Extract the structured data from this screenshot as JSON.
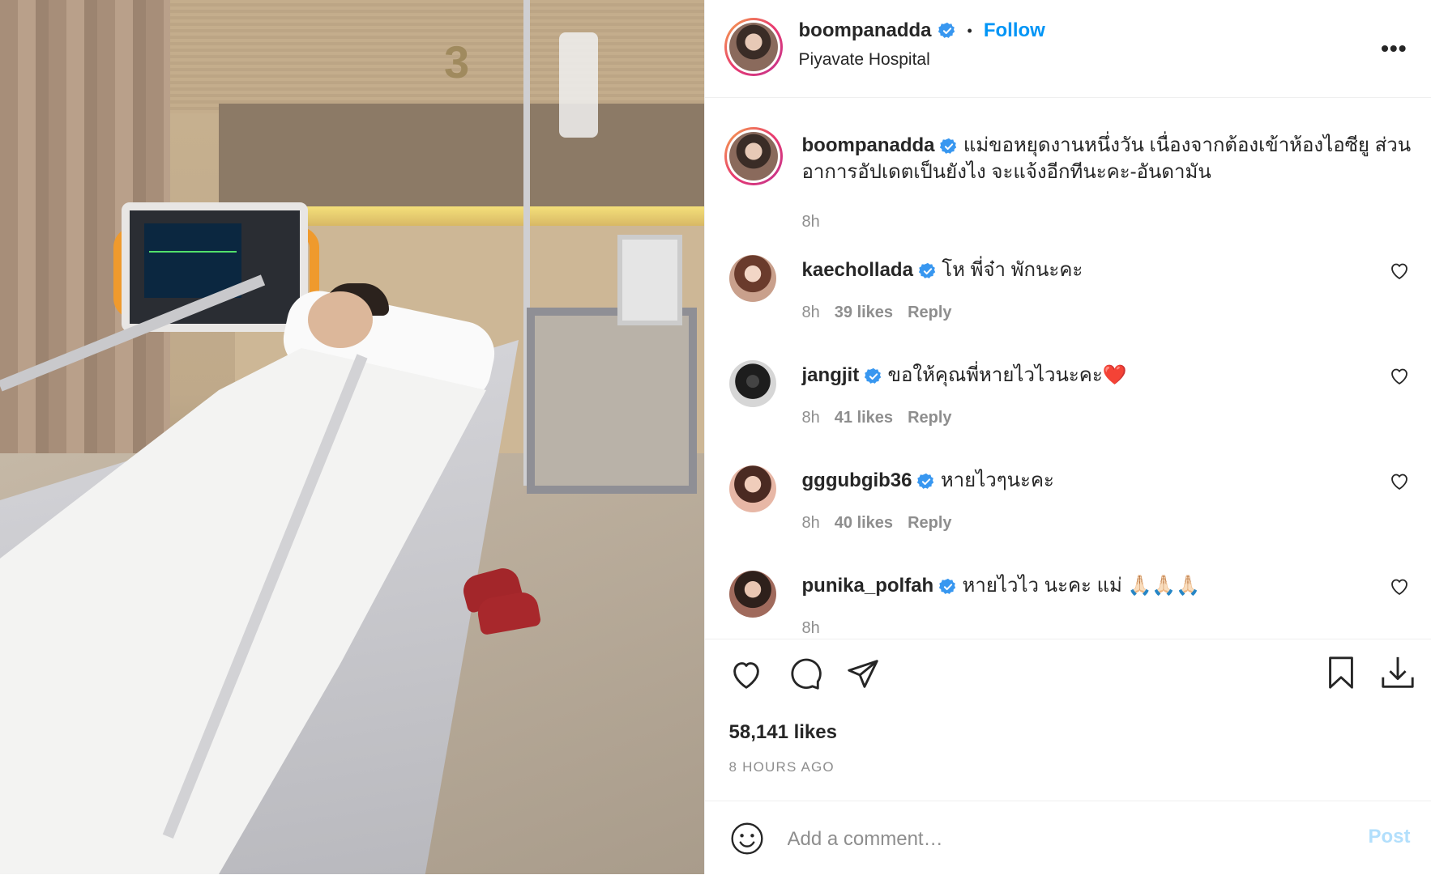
{
  "post": {
    "author": "boompanadda",
    "location": "Piyavate Hospital",
    "follow_label": "Follow",
    "separator": "•",
    "more_icon": "more-options-icon",
    "room_number": "3"
  },
  "caption": {
    "username": "boompanadda",
    "text_line1": "แม่ขอหยุดงานหนึ่งวัน เนื่องจากต้องเข้าห้องไอซียู ส่วน",
    "text_line2": "อาการอัปเดตเป็นยังไง จะแจ้งอีกทีนะคะ-อันดามัน",
    "time": "8h"
  },
  "comments": [
    {
      "username": "kaechollada",
      "text": "โห พี่จ๋า พักนะคะ",
      "time": "8h",
      "likes": "39 likes",
      "reply": "Reply"
    },
    {
      "username": "jangjit",
      "text": "ขอให้คุณพี่หายไวไวนะคะ❤️",
      "time": "8h",
      "likes": "41 likes",
      "reply": "Reply"
    },
    {
      "username": "gggubgib36",
      "text": "หายไวๆนะคะ",
      "time": "8h",
      "likes": "40 likes",
      "reply": "Reply"
    },
    {
      "username": "punika_polfah",
      "text": "หายไวไว นะคะ แม่ 🙏🏻🙏🏻🙏🏻",
      "time": "8h",
      "likes": "",
      "reply": ""
    }
  ],
  "stats": {
    "likes": "58,141 likes",
    "posted": "8 HOURS AGO"
  },
  "composer": {
    "placeholder": "Add a comment…",
    "post_label": "Post"
  },
  "colors": {
    "link_blue": "#0095f6",
    "verified_blue": "#3897f0",
    "muted": "#8e8e8e",
    "post_disabled": "#b2dffc",
    "text": "#262626"
  }
}
